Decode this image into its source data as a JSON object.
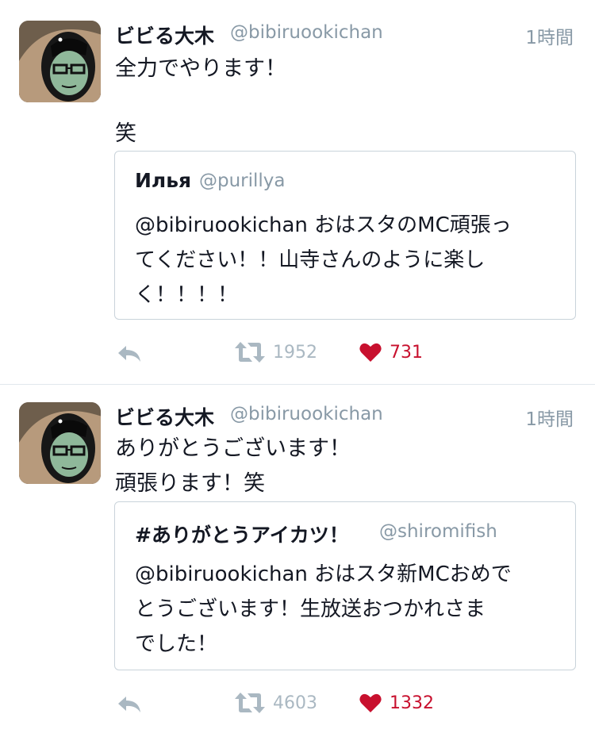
{
  "tweets": [
    {
      "display_name": "ビビる大木",
      "handle": "@bibiruookichan",
      "time": "1時間",
      "body_lines": [
        "全力でやります！",
        "",
        "笑"
      ],
      "quote": {
        "name": "Илья",
        "handle": "@purillya",
        "text_lines": [
          "@bibiruookichan おはスタのMC頑張っ",
          "てください！！山寺さんのように楽し",
          "く！！！！"
        ]
      },
      "reply_icon": "reply-icon",
      "retweet_icon": "retweet-icon",
      "retweets": "1952",
      "like_icon": "heart-icon",
      "likes": "731"
    },
    {
      "display_name": "ビビる大木",
      "handle": "@bibiruookichan",
      "time": "1時間",
      "body_lines": [
        "ありがとうございます！",
        "頑張ります！笑"
      ],
      "quote": {
        "name": "#ありがとうアイカツ！",
        "handle": "@shiromifish",
        "text_lines": [
          "@bibiruookichan おはスタ新MCおめで",
          "とうございます！生放送おつかれさま",
          "でした！"
        ]
      },
      "reply_icon": "reply-icon",
      "retweet_icon": "retweet-icon",
      "retweets": "4603",
      "like_icon": "heart-icon",
      "likes": "1332"
    }
  ],
  "colors": {
    "text": "#141823",
    "secondary": "#8899a6",
    "icon": "#aab8c2",
    "like": "#c8102e",
    "divider": "#e1e8ed"
  }
}
